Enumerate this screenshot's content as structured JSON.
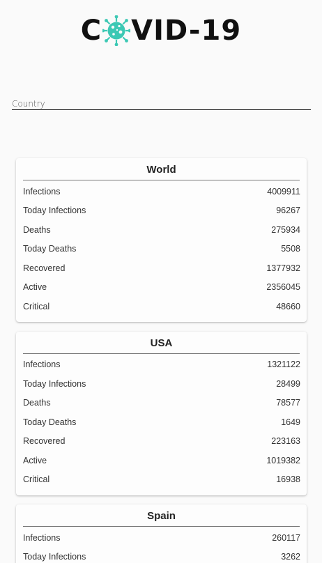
{
  "app": {
    "logo_left": "C",
    "logo_right": "VID-19",
    "logo_icon": "virus-icon",
    "accent_color": "#3cc8b4"
  },
  "search": {
    "placeholder": "Country",
    "value": ""
  },
  "cards": [
    {
      "title": "World",
      "stats": [
        {
          "label": "Infections",
          "value": "4009911"
        },
        {
          "label": "Today Infections",
          "value": "96267"
        },
        {
          "label": "Deaths",
          "value": "275934"
        },
        {
          "label": "Today Deaths",
          "value": "5508"
        },
        {
          "label": "Recovered",
          "value": "1377932"
        },
        {
          "label": "Active",
          "value": "2356045"
        },
        {
          "label": "Critical",
          "value": "48660"
        }
      ]
    },
    {
      "title": "USA",
      "stats": [
        {
          "label": "Infections",
          "value": "1321122"
        },
        {
          "label": "Today Infections",
          "value": "28499"
        },
        {
          "label": "Deaths",
          "value": "78577"
        },
        {
          "label": "Today Deaths",
          "value": "1649"
        },
        {
          "label": "Recovered",
          "value": "223163"
        },
        {
          "label": "Active",
          "value": "1019382"
        },
        {
          "label": "Critical",
          "value": "16938"
        }
      ]
    },
    {
      "title": "Spain",
      "stats": [
        {
          "label": "Infections",
          "value": "260117"
        },
        {
          "label": "Today Infections",
          "value": "3262"
        }
      ]
    }
  ]
}
